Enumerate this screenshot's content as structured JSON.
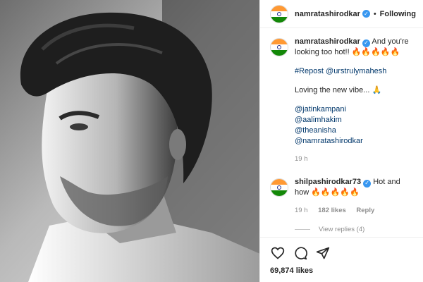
{
  "header": {
    "username": "namratashirodkar",
    "separator": "•",
    "follow_label": "Following"
  },
  "caption": {
    "username": "namratashirodkar",
    "text": "And you're looking too hot!! 🔥🔥🔥🔥🔥",
    "repost": "#Repost @urstrulymahesh",
    "body": "Loving the new vibe... 🙏",
    "mentions": [
      "@jatinkampani",
      "@aalimhakim",
      "@theanisha",
      "@namratashirodkar"
    ],
    "time": "19 h"
  },
  "comment": {
    "username": "shilpashirodkar73",
    "text": "Hot and how 🔥🔥🔥🔥🔥",
    "time": "19 h",
    "likes": "182 likes",
    "reply_label": "Reply",
    "view_replies": "View replies (4)"
  },
  "post": {
    "likes": "69,874 likes"
  },
  "icons": {
    "like": "heart-icon",
    "comment": "comment-icon",
    "share": "share-icon",
    "verified": "verified-badge-icon",
    "flag": "india-flag-avatar"
  },
  "colors": {
    "verified": "#3897f0",
    "saffron": "#ff9933",
    "green": "#138808",
    "link": "#00376b"
  }
}
